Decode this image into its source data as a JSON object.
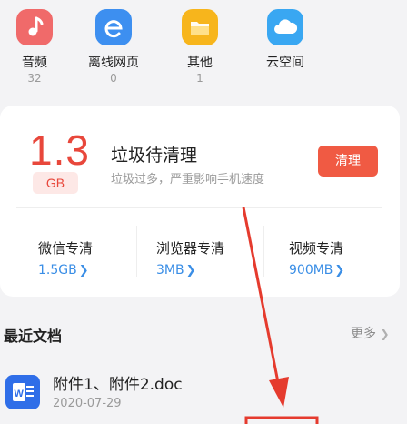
{
  "categories": [
    {
      "label": "音频",
      "count": "32",
      "icon": "music-note-icon",
      "color": "#f06a6a"
    },
    {
      "label": "离线网页",
      "count": "0",
      "icon": "browser-e-icon",
      "color": "#3d8ff0"
    },
    {
      "label": "其他",
      "count": "1",
      "icon": "folder-icon",
      "color": "#f7b51c"
    },
    {
      "label": "云空间",
      "count": "",
      "icon": "cloud-icon",
      "color": "#39a7f2"
    }
  ],
  "cleanup": {
    "size": "1.3",
    "unit": "GB",
    "title": "垃圾待清理",
    "description": "垃圾过多，严重影响手机速度",
    "button": "清理",
    "accent_color": "#f05a43",
    "items": [
      {
        "name": "微信专清",
        "value": "1.5GB"
      },
      {
        "name": "浏览器专清",
        "value": "3MB"
      },
      {
        "name": "视频专清",
        "value": "900MB"
      }
    ]
  },
  "recent": {
    "title": "最近文档",
    "more": "更多",
    "documents": [
      {
        "name": "附件1、附件2.doc",
        "date": "2020-07-29",
        "icon": "word-doc-icon"
      }
    ]
  }
}
